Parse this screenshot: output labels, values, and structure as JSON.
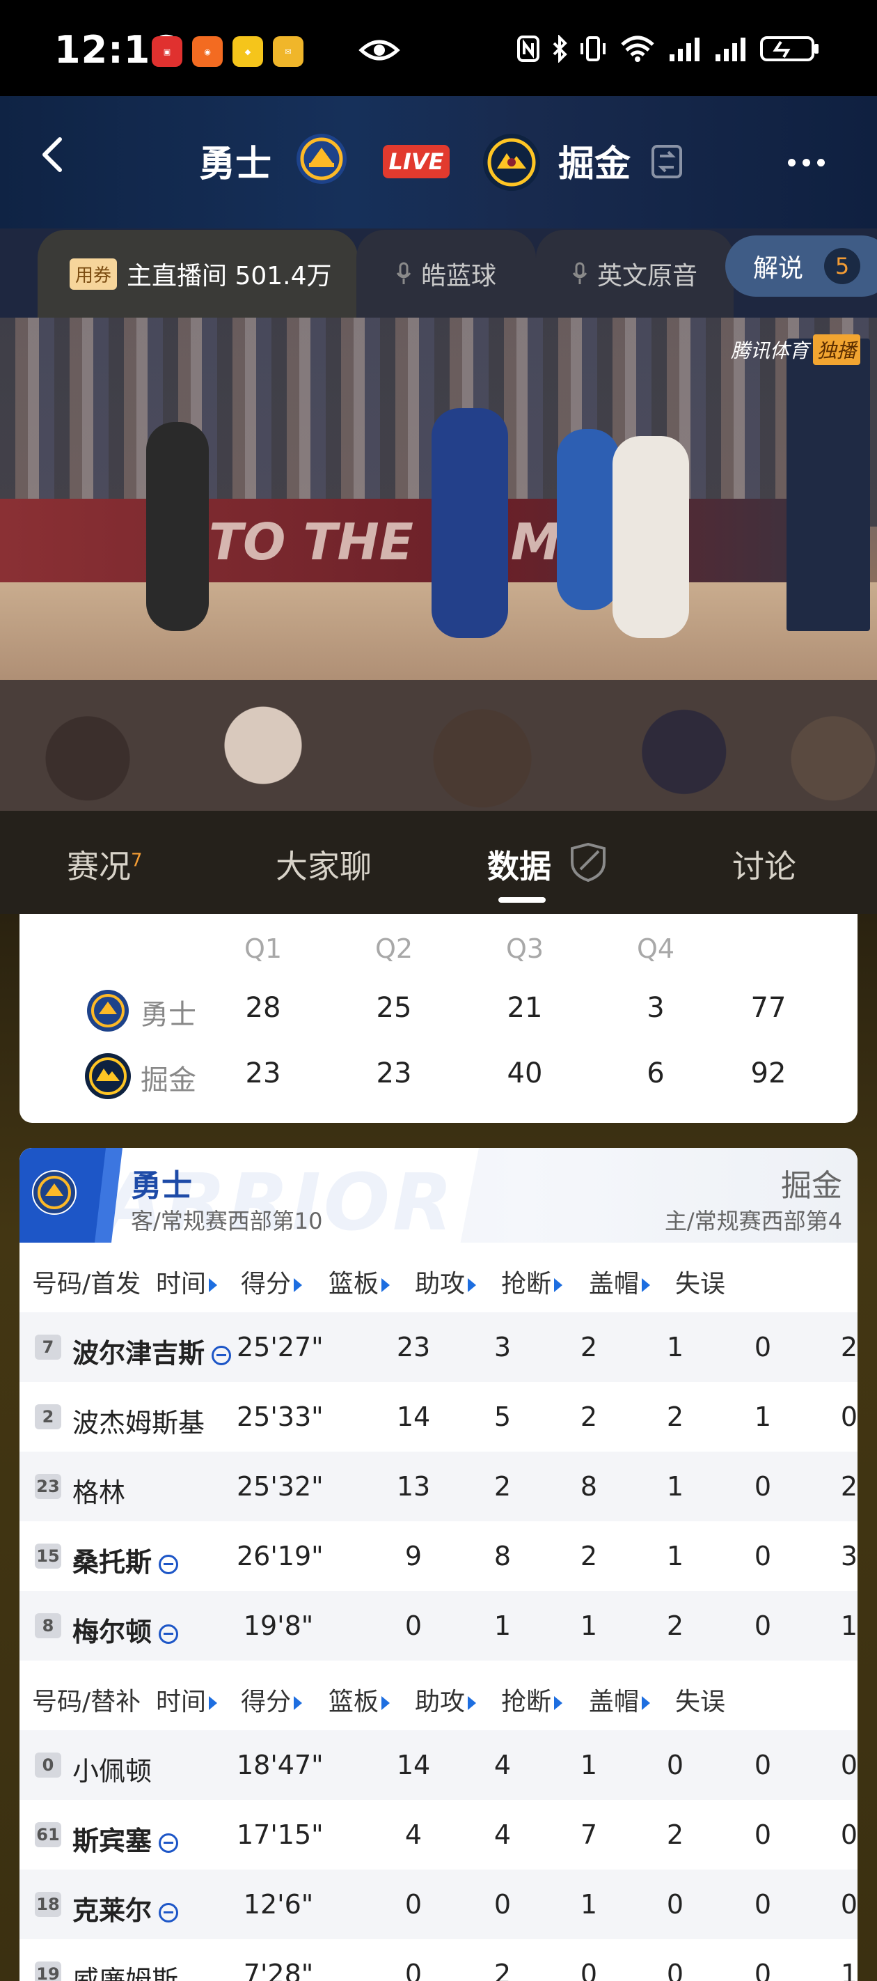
{
  "status_bar": {
    "time": "12:16"
  },
  "header": {
    "away_team": "勇士",
    "home_team": "掘金",
    "live_label": "LIVE"
  },
  "channels": {
    "coupon": "用券",
    "main_label": "主直播间 501.4万",
    "ch2": "皓蓝球",
    "ch3": "英文原音",
    "commentary": "解说",
    "commentary_count": "5"
  },
  "video": {
    "watermark": "腾讯体育",
    "watermark_tag": "独播",
    "banner_text": "TO THE GAME"
  },
  "tabs": {
    "t1": "赛况",
    "t1_badge": "7",
    "t2": "大家聊",
    "t3": "数据",
    "t4": "讨论"
  },
  "quarters": {
    "headers": [
      "Q1",
      "Q2",
      "Q3",
      "Q4"
    ],
    "teams": [
      {
        "name": "勇士",
        "scores": [
          "28",
          "25",
          "21",
          "3"
        ],
        "total": "77"
      },
      {
        "name": "掘金",
        "scores": [
          "23",
          "23",
          "40",
          "6"
        ],
        "total": "92"
      }
    ]
  },
  "boxscore": {
    "bg_word": "ARRIOR",
    "team": "勇士",
    "team_sub": "客/常规赛西部第10",
    "opp": "掘金",
    "opp_sub": "主/常规赛西部第4",
    "columns": [
      "时间",
      "得分",
      "篮板",
      "助攻",
      "抢断",
      "盖帽",
      "失误"
    ],
    "starters_label": "号码/首发",
    "bench_label": "号码/替补",
    "starters": [
      {
        "num": "7",
        "name": "波尔津吉斯",
        "time": "25'27\"",
        "pts": "23",
        "reb": "3",
        "ast": "2",
        "stl": "1",
        "blk": "0",
        "tov": "2"
      },
      {
        "num": "2",
        "name": "波杰姆斯基",
        "time": "25'33\"",
        "pts": "14",
        "reb": "5",
        "ast": "2",
        "stl": "2",
        "blk": "1",
        "tov": "0"
      },
      {
        "num": "23",
        "name": "格林",
        "time": "25'32\"",
        "pts": "13",
        "reb": "2",
        "ast": "8",
        "stl": "1",
        "blk": "0",
        "tov": "2"
      },
      {
        "num": "15",
        "name": "桑托斯",
        "time": "26'19\"",
        "pts": "9",
        "reb": "8",
        "ast": "2",
        "stl": "1",
        "blk": "0",
        "tov": "3"
      },
      {
        "num": "8",
        "name": "梅尔顿",
        "time": "19'8\"",
        "pts": "0",
        "reb": "1",
        "ast": "1",
        "stl": "2",
        "blk": "0",
        "tov": "1"
      }
    ],
    "bench": [
      {
        "num": "0",
        "name": "小佩顿",
        "time": "18'47\"",
        "pts": "14",
        "reb": "4",
        "ast": "1",
        "stl": "0",
        "blk": "0",
        "tov": "0"
      },
      {
        "num": "61",
        "name": "斯宾塞",
        "time": "17'15\"",
        "pts": "4",
        "reb": "4",
        "ast": "7",
        "stl": "2",
        "blk": "0",
        "tov": "0"
      },
      {
        "num": "18",
        "name": "克莱尔",
        "time": "12'6\"",
        "pts": "0",
        "reb": "0",
        "ast": "1",
        "stl": "0",
        "blk": "0",
        "tov": "0"
      },
      {
        "num": "19",
        "name": "威廉姆斯",
        "time": "7'28\"",
        "pts": "0",
        "reb": "2",
        "ast": "0",
        "stl": "0",
        "blk": "0",
        "tov": "1"
      }
    ]
  }
}
